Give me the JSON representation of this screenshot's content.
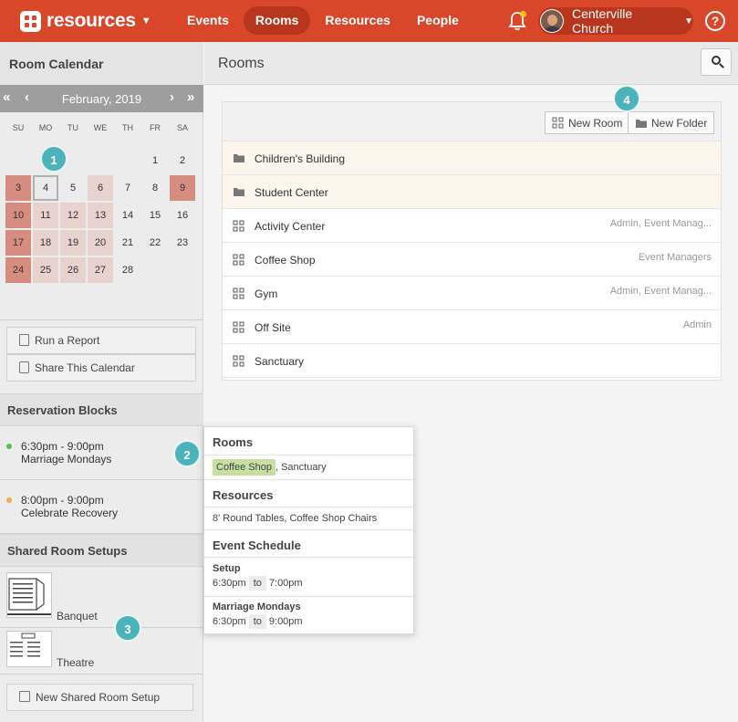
{
  "header": {
    "brand": "resources",
    "nav": [
      "Events",
      "Rooms",
      "Resources",
      "People"
    ],
    "active_nav": "Rooms",
    "user_name": "Centerville Church",
    "help": "?"
  },
  "sidebar": {
    "title": "Room Calendar",
    "calendar": {
      "month": "February, 2019",
      "prev_year": "«",
      "prev_month": "‹",
      "next_month": "›",
      "next_year": "»",
      "weekdays": [
        "SU",
        "MO",
        "TU",
        "WE",
        "TH",
        "FR",
        "SA"
      ],
      "weeks": [
        [
          "",
          "",
          "",
          "",
          "",
          "1",
          "2"
        ],
        [
          "3",
          "4",
          "5",
          "6",
          "7",
          "8",
          "9"
        ],
        [
          "10",
          "11",
          "12",
          "13",
          "14",
          "15",
          "16"
        ],
        [
          "17",
          "18",
          "19",
          "20",
          "21",
          "22",
          "23"
        ],
        [
          "24",
          "25",
          "26",
          "27",
          "28",
          "",
          ""
        ]
      ],
      "today": "4"
    },
    "buttons": [
      "Run a Report",
      "Share This Calendar"
    ],
    "reservation_title": "Reservation Blocks",
    "blocks": [
      {
        "time": "6:30pm - 9:00pm",
        "name": "Marriage Mondays",
        "color": "#5cb85c"
      },
      {
        "time": "8:00pm - 9:00pm",
        "name": "Celebrate Recovery",
        "color": "#f0ad4e"
      }
    ],
    "setups_title": "Shared Room Setups",
    "setups": [
      "Banquet",
      "Theatre"
    ],
    "new_setup": "New Shared Room Setup"
  },
  "main": {
    "title": "Rooms",
    "new_room": "New Room",
    "new_folder": "New Folder",
    "rows": [
      {
        "type": "folder",
        "name": "Children's Building",
        "perm": ""
      },
      {
        "type": "folder",
        "name": "Student Center",
        "perm": ""
      },
      {
        "type": "room",
        "name": "Activity Center",
        "perm": "Admin, Event Manag..."
      },
      {
        "type": "room",
        "name": "Coffee Shop",
        "perm": "Event Managers"
      },
      {
        "type": "room",
        "name": "Gym",
        "perm": "Admin, Event Manag..."
      },
      {
        "type": "room",
        "name": "Off Site",
        "perm": "Admin"
      },
      {
        "type": "room",
        "name": "Sanctuary",
        "perm": ""
      }
    ]
  },
  "popup": {
    "rooms_title": "Rooms",
    "room_highlight": "Coffee Shop",
    "room_rest": ", Sanctuary",
    "resources_title": "Resources",
    "resources": "8' Round Tables, Coffee Shop Chairs",
    "schedule_title": "Event Schedule",
    "setup_label": "Setup",
    "setup_start": "6:30pm",
    "setup_end": "7:00pm",
    "event_label": "Marriage Mondays",
    "event_start": "6:30pm",
    "event_end": "9:00pm",
    "to": "to"
  },
  "badges": [
    "1",
    "2",
    "3",
    "4"
  ]
}
